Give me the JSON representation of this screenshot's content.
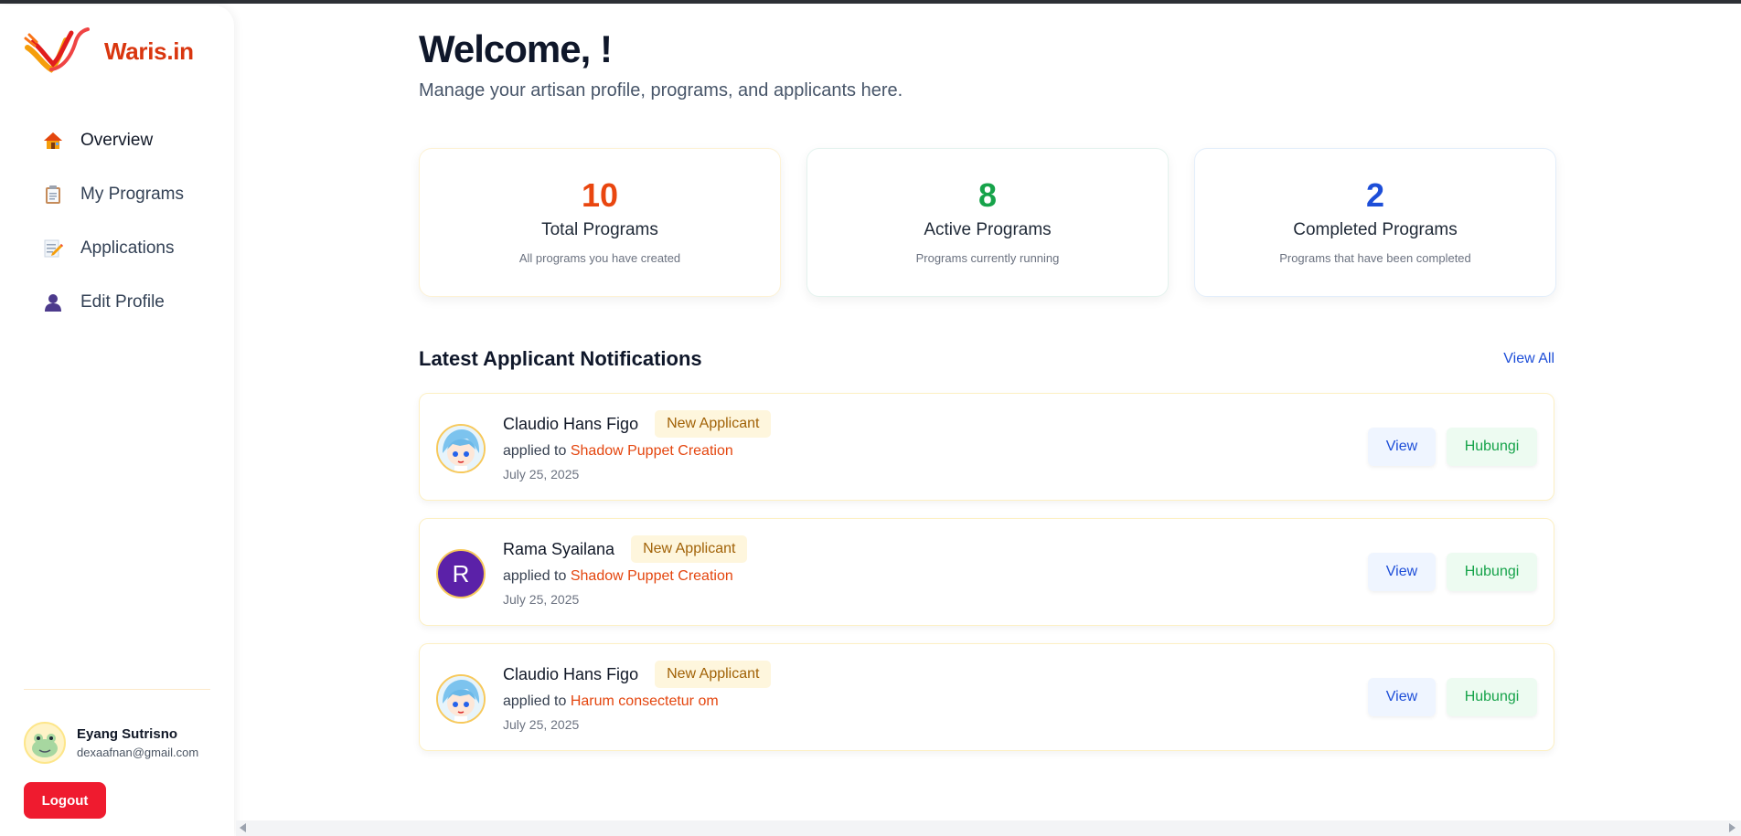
{
  "brand": {
    "name": "Waris.in",
    "logo_icon": "waris-flame-logo-icon",
    "color": "#d9360f"
  },
  "sidebar": {
    "items": [
      {
        "label": "Overview",
        "icon": "house-icon",
        "active": true
      },
      {
        "label": "My Programs",
        "icon": "clipboard-icon",
        "active": false
      },
      {
        "label": "Applications",
        "icon": "memo-icon",
        "active": false
      },
      {
        "label": "Edit Profile",
        "icon": "user-silhouette-icon",
        "active": false
      }
    ],
    "user": {
      "name": "Eyang Sutrisno",
      "email": "dexaafnan@gmail.com",
      "avatar_icon": "frog-avatar-icon"
    },
    "logout_label": "Logout"
  },
  "header": {
    "title": "Welcome, !",
    "subtitle": "Manage your artisan profile, programs, and applicants here."
  },
  "stats": [
    {
      "value": "10",
      "title": "Total Programs",
      "desc": "All programs you have created",
      "color": "#e9460f"
    },
    {
      "value": "8",
      "title": "Active Programs",
      "desc": "Programs currently running",
      "color": "#16a34a"
    },
    {
      "value": "2",
      "title": "Completed Programs",
      "desc": "Programs that have been completed",
      "color": "#1d4ed8"
    }
  ],
  "notifications": {
    "title": "Latest Applicant Notifications",
    "view_all_label": "View All",
    "items": [
      {
        "name": "Claudio Hans Figo",
        "badge": "New Applicant",
        "applied_prefix": "applied to",
        "program": "Shadow Puppet Creation",
        "date": "July 25, 2025",
        "avatar": "anime-avatar-icon",
        "avatar_letter": "",
        "view_label": "View",
        "contact_label": "Hubungi"
      },
      {
        "name": "Rama Syailana",
        "badge": "New Applicant",
        "applied_prefix": "applied to",
        "program": "Shadow Puppet Creation",
        "date": "July 25, 2025",
        "avatar": "letter-avatar",
        "avatar_letter": "R",
        "view_label": "View",
        "contact_label": "Hubungi"
      },
      {
        "name": "Claudio Hans Figo",
        "badge": "New Applicant",
        "applied_prefix": "applied to",
        "program": "Harum consectetur om",
        "date": "July 25, 2025",
        "avatar": "anime-avatar-icon",
        "avatar_letter": "",
        "view_label": "View",
        "contact_label": "Hubungi"
      }
    ]
  }
}
